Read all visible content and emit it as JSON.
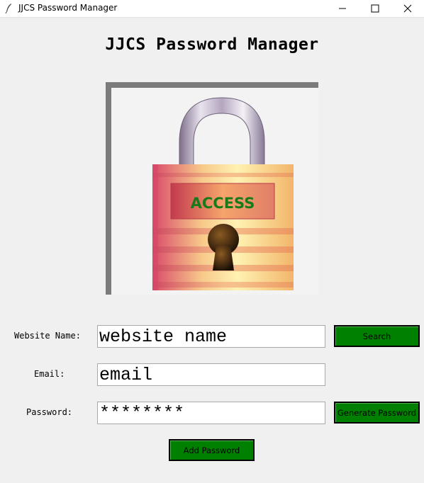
{
  "window": {
    "title": "JJCS Password Manager",
    "controls": {
      "minimize": "—",
      "maximize": "☐",
      "close": "✕"
    }
  },
  "heading": "JJCS Password Manager",
  "logo": {
    "text": "ACCESS",
    "icon": "padlock-icon"
  },
  "form": {
    "website_label": "Website Name:",
    "website_value": "website name",
    "email_label": "Email:",
    "email_value": "email",
    "password_label": "Password:",
    "password_value": "********"
  },
  "buttons": {
    "search": "Search",
    "generate": "Generate Password",
    "add": "Add Password"
  },
  "colors": {
    "button_green": "#008000",
    "logo_text": "#1a7a1a"
  }
}
